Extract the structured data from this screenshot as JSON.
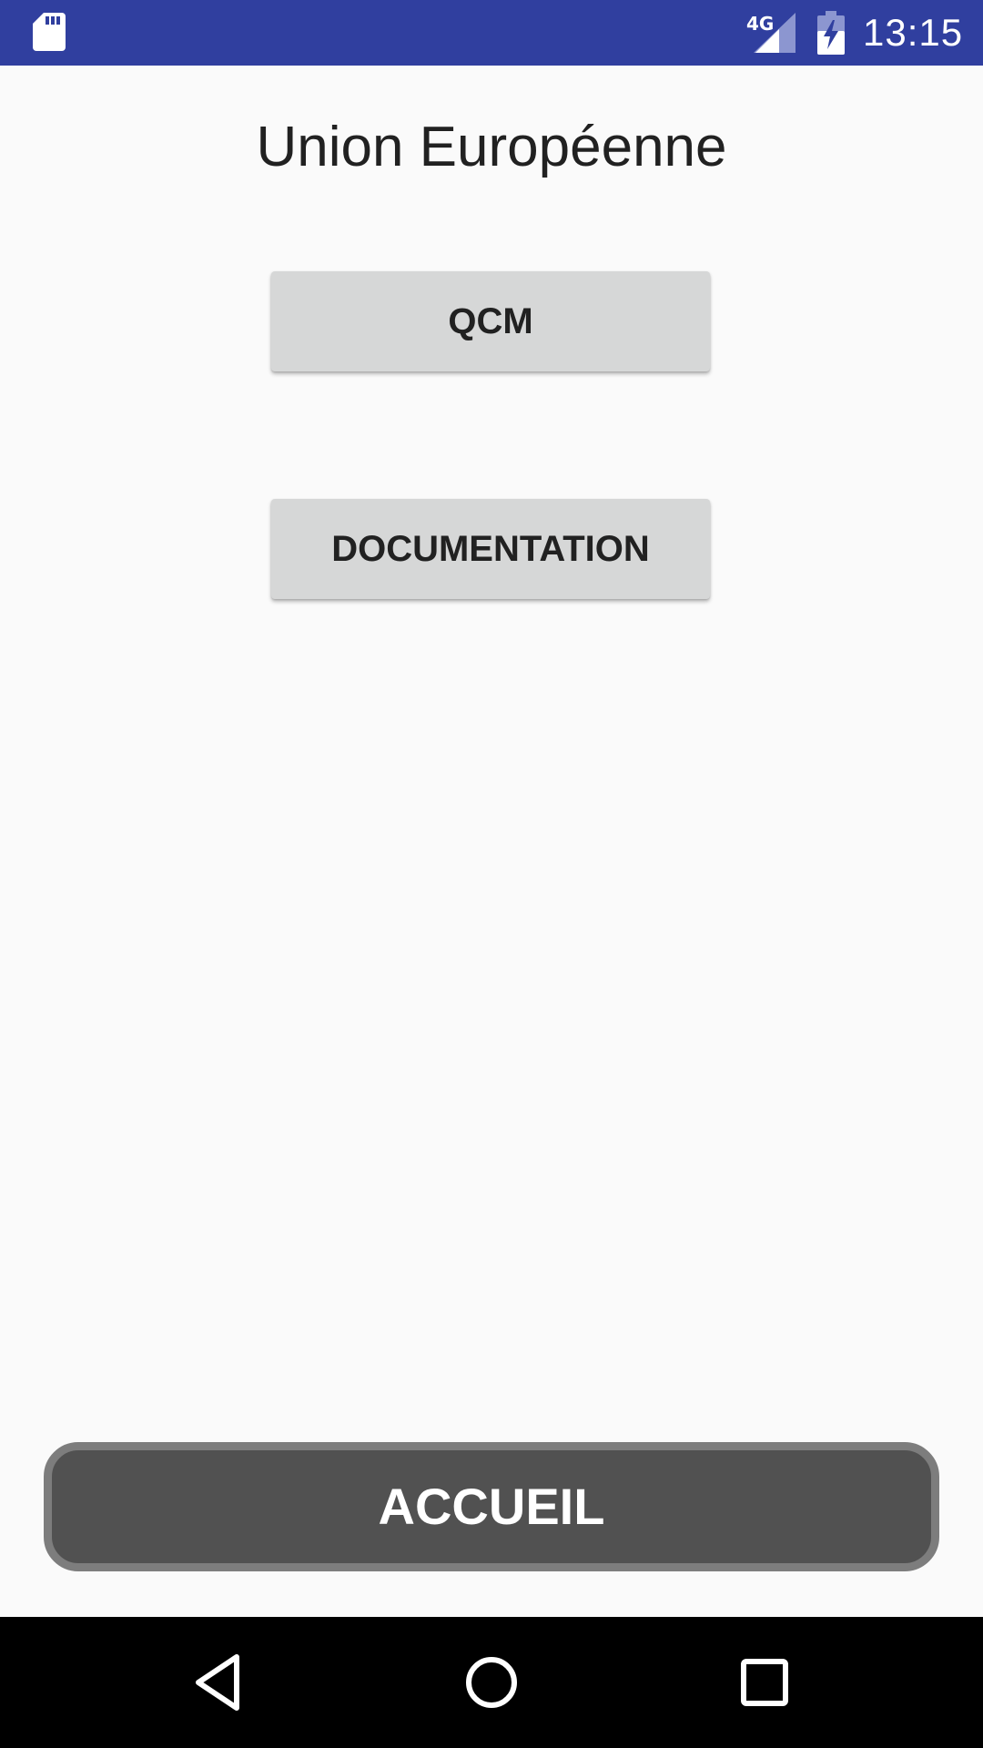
{
  "status_bar": {
    "network": "4G",
    "time": "13:15",
    "icons": [
      "sd-card-icon",
      "cell-signal-icon",
      "battery-charging-icon"
    ]
  },
  "page": {
    "title": "Union Européenne"
  },
  "buttons": {
    "qcm": "QCM",
    "documentation": "DOCUMENTATION",
    "home": "ACCUEIL"
  },
  "nav_bar": {
    "icons": [
      "back-icon",
      "home-icon",
      "recents-icon"
    ]
  },
  "colors": {
    "status_bar": "#303f9f",
    "background": "#fafafa",
    "menu_button": "#d6d7d7",
    "home_button": "#515151",
    "home_button_border": "#7d7d7d",
    "nav_bar": "#000000"
  }
}
